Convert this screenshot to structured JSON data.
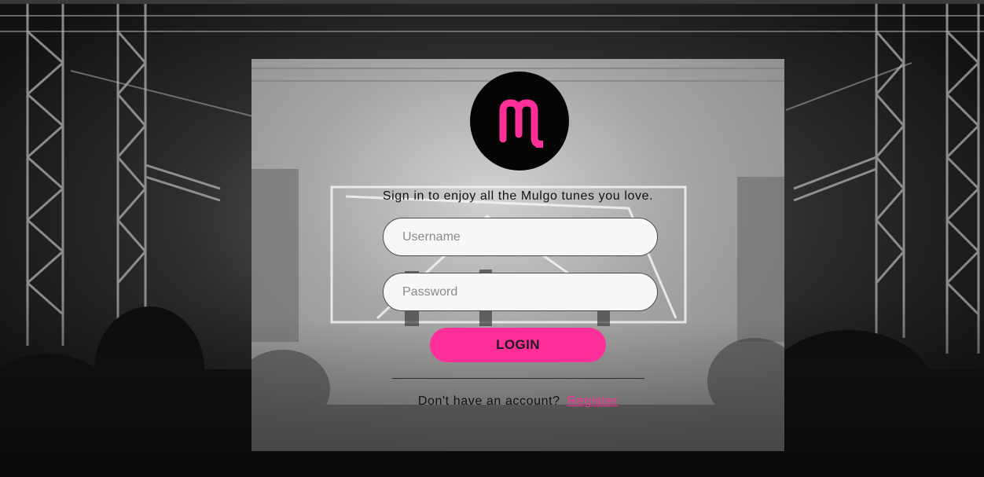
{
  "brand": {
    "logo_icon": "mulgo-m-logo-icon",
    "accent_color": "#ff2f9a"
  },
  "login_form": {
    "tagline": "Sign in to enjoy all the Mulgo tunes you love.",
    "username_placeholder": "Username",
    "password_placeholder": "Password",
    "login_label": "LOGIN",
    "signup_prompt": "Don't have an account?",
    "register_label": "Register"
  }
}
